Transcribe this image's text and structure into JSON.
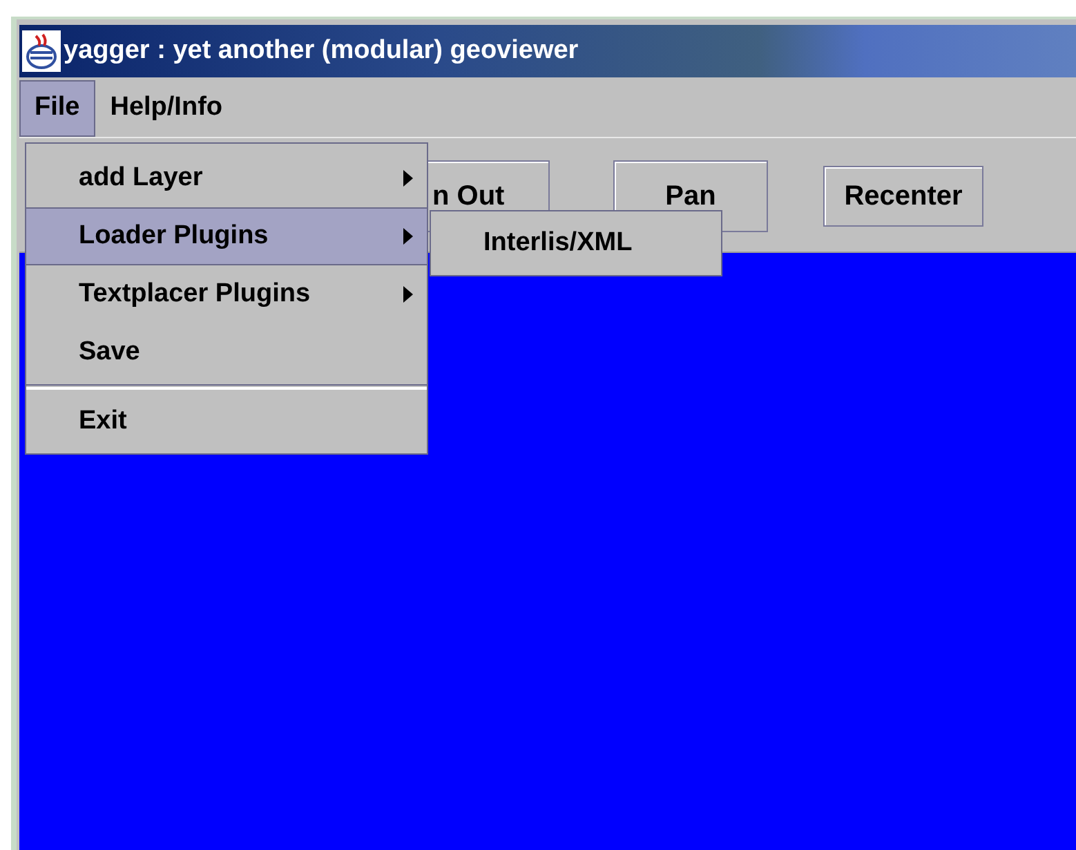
{
  "window": {
    "title": "yagger : yet another (modular) geoviewer"
  },
  "menubar": [
    {
      "label": "File",
      "selected": true
    },
    {
      "label": "Help/Info",
      "selected": false
    }
  ],
  "toolbar": [
    {
      "label": "n Out"
    },
    {
      "label": "Pan"
    },
    {
      "label": "Recenter"
    }
  ],
  "file_menu": [
    {
      "kind": "submenu",
      "label": "add Layer",
      "selected": false
    },
    {
      "kind": "submenu",
      "label": "Loader Plugins",
      "selected": true
    },
    {
      "kind": "submenu",
      "label": "Textplacer Plugins",
      "selected": false
    },
    {
      "kind": "item",
      "label": "Save",
      "selected": false
    },
    {
      "kind": "separator"
    },
    {
      "kind": "item",
      "label": "Exit",
      "selected": false
    }
  ],
  "loader_submenu": [
    {
      "label": "Interlis/XML",
      "selected": false
    }
  ]
}
